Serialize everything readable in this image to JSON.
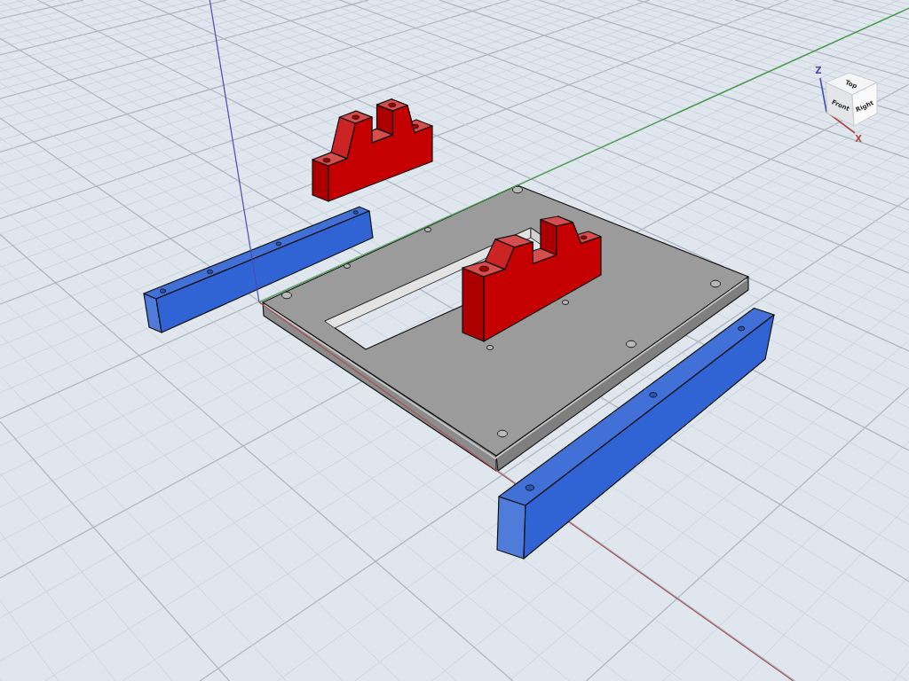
{
  "viewport": {
    "axes": [
      {
        "kind": "z",
        "color": "#4b4bb4"
      },
      {
        "kind": "y",
        "color": "#3f9a3f"
      },
      {
        "kind": "x",
        "color": "#a85050"
      }
    ]
  },
  "parts": [
    {
      "kind": "bracket",
      "color": "#c40000"
    },
    {
      "kind": "rail",
      "color": "#3064d4"
    },
    {
      "kind": "plate",
      "color": "#9b9b9b"
    },
    {
      "kind": "bracket",
      "color": "#c40000"
    },
    {
      "kind": "rail",
      "color": "#3064d4"
    }
  ],
  "view_cube": {
    "faces": [
      {
        "kind": "top",
        "label": "Top"
      },
      {
        "kind": "front",
        "label": "Front"
      },
      {
        "kind": "right",
        "label": "Right"
      }
    ],
    "triad": [
      {
        "kind": "z",
        "label": "Z",
        "color": "#4b4bb4"
      },
      {
        "kind": "x",
        "label": "X",
        "color": "#b04848"
      }
    ]
  }
}
